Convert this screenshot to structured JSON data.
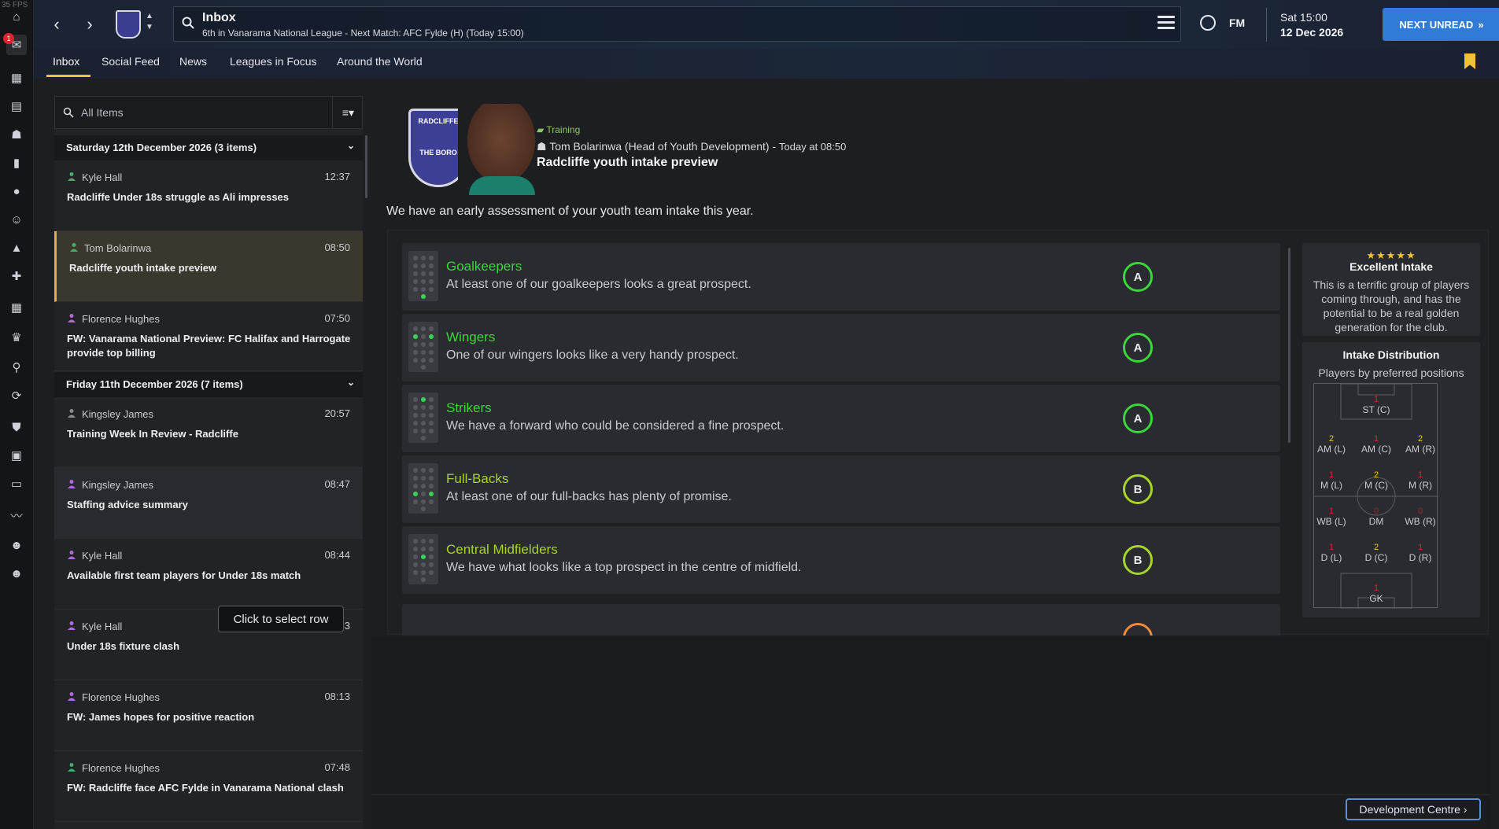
{
  "overlay": {
    "fps": "35 FPS"
  },
  "header": {
    "title": "Inbox",
    "subtitle": "6th in Vanarama National League - Next Match: AFC Fylde (H) (Today 15:00)",
    "fm_label": "FM",
    "date_line1": "Sat 15:00",
    "date_line2": "12 Dec 2026",
    "next_unread": "NEXT UNREAD",
    "notification_count": "1"
  },
  "tabs": [
    "Inbox",
    "Social Feed",
    "News",
    "Leagues in Focus",
    "Around the World"
  ],
  "filter": {
    "placeholder": "All Items"
  },
  "groups": [
    {
      "label": "Saturday 12th December 2026 (3 items)"
    },
    {
      "label": "Friday 11th December 2026 (7 items)"
    }
  ],
  "messages": [
    {
      "from": "Kyle Hall",
      "time": "12:37",
      "subject": "Radcliffe Under 18s struggle as Ali impresses"
    },
    {
      "from": "Tom Bolarinwa",
      "time": "08:50",
      "subject": "Radcliffe youth intake preview"
    },
    {
      "from": "Florence Hughes",
      "time": "07:50",
      "subject": "FW: Vanarama National Preview: FC Halifax and Harrogate provide top billing"
    },
    {
      "from": "Kingsley James",
      "time": "20:57",
      "subject": "Training Week In Review - Radcliffe"
    },
    {
      "from": "Kingsley James",
      "time": "08:47",
      "subject": "Staffing advice summary"
    },
    {
      "from": "Kyle Hall",
      "time": "08:44",
      "subject": "Available first team players for Under 18s match"
    },
    {
      "from": "Kyle Hall",
      "time": "08:33",
      "subject": "Under 18s fixture clash"
    },
    {
      "from": "Florence Hughes",
      "time": "08:13",
      "subject": "FW: James hopes for positive reaction"
    },
    {
      "from": "Florence Hughes",
      "time": "07:48",
      "subject": "FW: Radcliffe face AFC Fylde in Vanarama National clash"
    }
  ],
  "tooltip": "Click to select row",
  "detail": {
    "crest_top": "RADCLIFFE",
    "crest_bottom": "THE BORO",
    "category": "Training",
    "sender": "Tom Bolarinwa (Head of Youth Development)",
    "when": "Today at 08:50",
    "title": "Radcliffe youth intake preview",
    "body": "We have an early assessment of your youth team intake this year."
  },
  "position_groups": [
    {
      "name": "Goalkeepers",
      "desc": "At least one of our goalkeepers looks a great prospect.",
      "grade": "A"
    },
    {
      "name": "Wingers",
      "desc": "One of our wingers looks like a very handy prospect.",
      "grade": "A"
    },
    {
      "name": "Strikers",
      "desc": "We have a forward who could be considered a fine prospect.",
      "grade": "A"
    },
    {
      "name": "Full-Backs",
      "desc": "At least one of our full-backs has plenty of promise.",
      "grade": "B"
    },
    {
      "name": "Central Midfielders",
      "desc": "We have what looks like a top prospect in the centre of midfield.",
      "grade": "B"
    }
  ],
  "colors": {
    "grade_a": "#3ad63a",
    "grade_b": "#a6d42a",
    "accent": "#f0c236",
    "primary_button": "#2f7bd6"
  },
  "summary": {
    "stars": "★★★★★",
    "rating": 5,
    "title": "Excellent Intake",
    "text": "This is a terrific group of players coming through, and has the potential to be a real golden generation for the club."
  },
  "distribution": {
    "title": "Intake Distribution",
    "subtitle": "Players by preferred positions",
    "positions": [
      {
        "label": "ST (C)",
        "count": "1"
      },
      {
        "label": "AM (L)",
        "count": "2"
      },
      {
        "label": "AM (C)",
        "count": "1"
      },
      {
        "label": "AM (R)",
        "count": "2"
      },
      {
        "label": "M (L)",
        "count": "1"
      },
      {
        "label": "M (C)",
        "count": "2"
      },
      {
        "label": "M (R)",
        "count": "1"
      },
      {
        "label": "WB (L)",
        "count": "1"
      },
      {
        "label": "DM",
        "count": "0"
      },
      {
        "label": "WB (R)",
        "count": "0"
      },
      {
        "label": "D (L)",
        "count": "1"
      },
      {
        "label": "D (C)",
        "count": "2"
      },
      {
        "label": "D (R)",
        "count": "1"
      },
      {
        "label": "GK",
        "count": "1"
      }
    ]
  },
  "footer": {
    "dev_centre": "Development Centre ›"
  }
}
